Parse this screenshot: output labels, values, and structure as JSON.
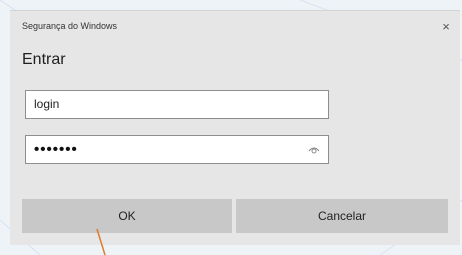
{
  "dialog": {
    "title": "Segurança do Windows",
    "close_glyph": "×",
    "heading": "Entrar",
    "username_value": "login",
    "password_mask": "•••••••",
    "ok_label": "OK",
    "cancel_label": "Cancelar"
  },
  "icons": {
    "close": "close-icon",
    "reveal": "eye-icon"
  },
  "colors": {
    "dialog_bg": "#e6e6e6",
    "button_bg": "#c8c8c8",
    "field_border": "#8e8e8e",
    "annotation_line": "#e07a2b"
  }
}
